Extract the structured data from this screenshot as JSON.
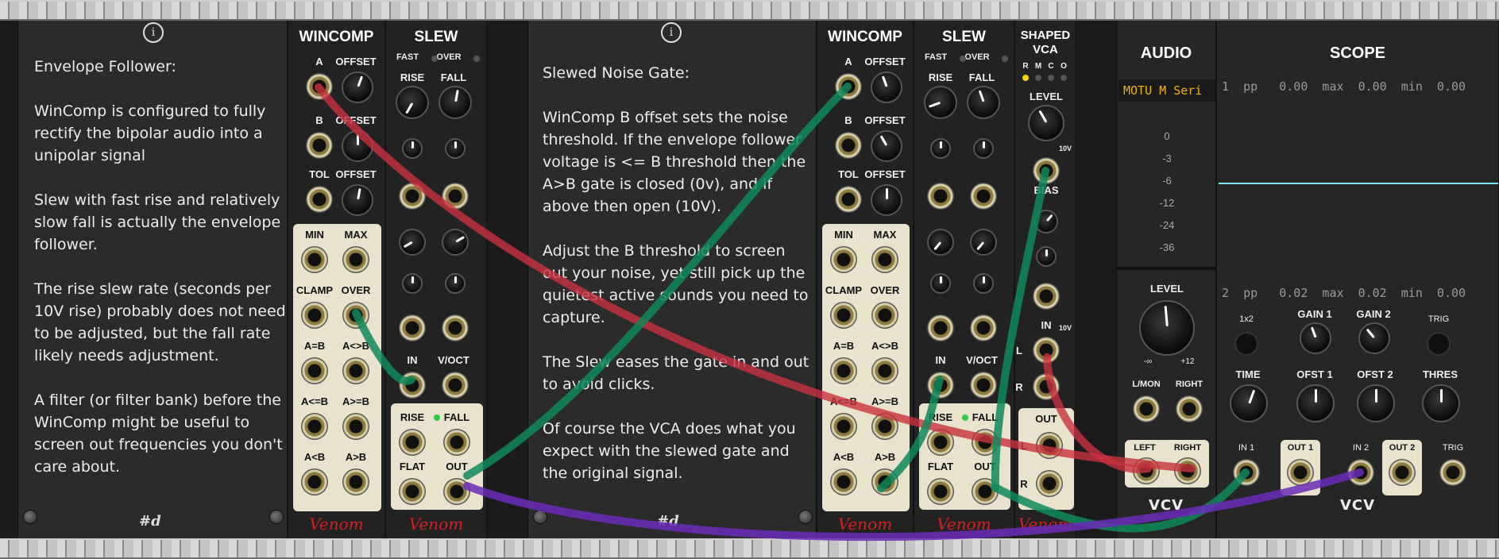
{
  "notes": {
    "envelope_follower": [
      "Envelope Follower:",
      "WinComp is configured to fully rectify the bipolar audio into a unipolar signal",
      "Slew with fast rise and relatively slow fall is actually the envelope follower.",
      "The rise slew rate (seconds per 10V rise) probably does not need to be adjusted, but the fall rate likely needs adjustment.",
      "A filter (or filter bank) before the WinComp might be useful to screen out frequencies you don't care about."
    ],
    "noise_gate": [
      "Slewed Noise Gate:",
      "WinComp B offset sets the noise threshold. If the envelope follower voltage is <= B threshold then the A>B gate is closed (0v), and if above then open (10V).",
      "Adjust the B threshold to screen out your noise, yet still pick up the quietest active sounds you need to capture.",
      "The Slew eases the gate in and out to avoid clicks.",
      "Of course the VCA does what you expect with the slewed gate and the original signal."
    ],
    "signature": "#d",
    "info_glyph": "i"
  },
  "wincomp": {
    "title": "WINCOMP",
    "labels": [
      "A",
      "OFFSET",
      "B",
      "OFFSET",
      "TOL",
      "OFFSET"
    ],
    "logic_labels": [
      "MIN",
      "MAX",
      "CLAMP",
      "OVER",
      "A=B",
      "A<>B",
      "A<=B",
      "A>=B",
      "A<B",
      "A>B"
    ],
    "brand": "Venom"
  },
  "slew": {
    "title": "SLEW",
    "fast_label": "FAST",
    "over_label": "OVER",
    "rise_label": "RISE",
    "fall_label": "FALL",
    "in_label": "IN",
    "voct_label": "V/OCT",
    "flat_label": "FLAT",
    "out_label": "OUT",
    "brand": "Venom"
  },
  "vca": {
    "title_line1": "SHAPED",
    "title_line2": "VCA",
    "mode_labels": [
      "R",
      "M",
      "C",
      "O"
    ],
    "level_label": "LEVEL",
    "tenv_label": "10V",
    "bias_label": "BIAS",
    "in_label": "IN",
    "l_label": "L",
    "r_label": "R",
    "out_label": "OUT",
    "brand": "Venom"
  },
  "audio": {
    "title": "AUDIO",
    "device": "MOTU M Seri",
    "meter_labels": [
      "0",
      "-3",
      "-6",
      "-12",
      "-24",
      "-36"
    ],
    "level_label": "LEVEL",
    "min_label": "-∞",
    "max_label": "+12",
    "lmon_label": "L/MON",
    "right_label": "RIGHT",
    "left_label": "LEFT",
    "right2_label": "RIGHT",
    "brand": "VCV"
  },
  "scope": {
    "title": "SCOPE",
    "ch1_readout": "1  pp   0.00  max  0.00  min  0.00",
    "ch2_readout": "2  pp   0.02  max  0.02  min  0.00",
    "x2_label": "1x2",
    "gain1_label": "GAIN 1",
    "gain2_label": "GAIN 2",
    "trig_label": "TRIG",
    "time_label": "TIME",
    "ofst1_label": "OFST 1",
    "ofst2_label": "OFST 2",
    "thres_label": "THRES",
    "in1_label": "IN 1",
    "out1_label": "OUT 1",
    "in2_label": "IN 2",
    "out2_label": "OUT 2",
    "trig2_label": "TRIG",
    "brand": "VCV",
    "trace_color": "#7fe8ff"
  },
  "cable_colors": {
    "red": "#c8323f",
    "green": "#0f8a5a",
    "purple": "#6a2bb8"
  }
}
